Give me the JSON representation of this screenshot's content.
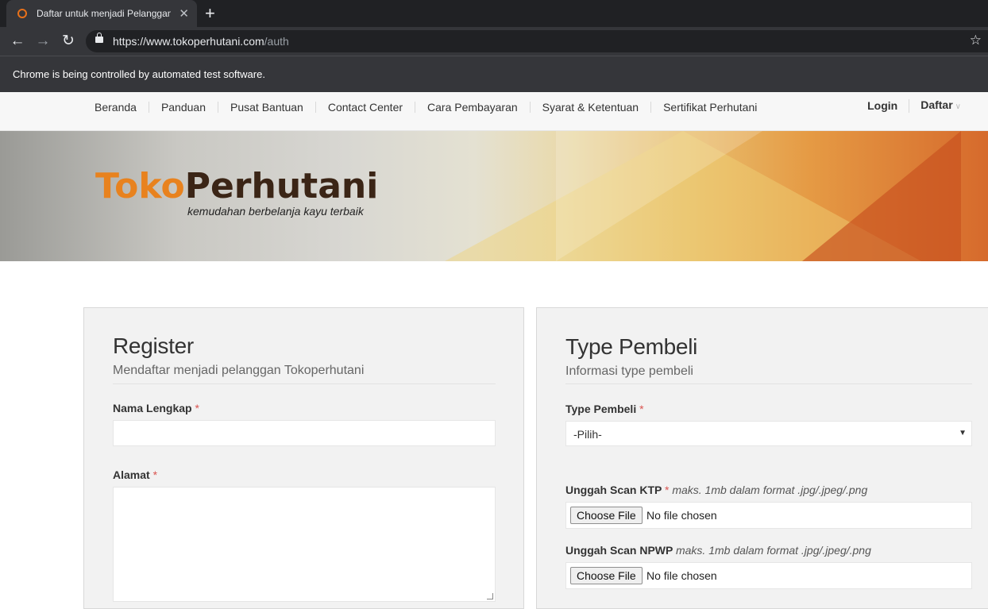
{
  "browser": {
    "tab_title": "Daftar untuk menjadi Pelanggan",
    "url_host": "https://www.tokoperhutani.com",
    "url_path": "/auth",
    "infobar_text": "Chrome is being controlled by automated test software."
  },
  "nav": {
    "items": [
      "Beranda",
      "Panduan",
      "Pusat Bantuan",
      "Contact Center",
      "Cara Pembayaran",
      "Syarat & Ketentuan",
      "Sertifikat Perhutani"
    ],
    "login": "Login",
    "daftar": "Daftar"
  },
  "banner": {
    "logo_part1": "Toko",
    "logo_part2": "Perhutani",
    "tagline": "kemudahan berbelanja kayu terbaik"
  },
  "register": {
    "title": "Register",
    "subtitle": "Mendaftar menjadi pelanggan Tokoperhutani",
    "nama_label": "Nama Lengkap",
    "nama_value": "",
    "alamat_label": "Alamat",
    "alamat_value": "",
    "required_mark": "*"
  },
  "type_pembeli": {
    "title": "Type Pembeli",
    "subtitle": "Informasi type pembeli",
    "select_label": "Type Pembeli",
    "select_value": "-Pilih-",
    "ktp_label": "Unggah Scan KTP",
    "ktp_hint": "maks. 1mb dalam format .jpg/.jpeg/.png",
    "npwp_label": "Unggah Scan NPWP",
    "npwp_hint": "maks. 1mb dalam format .jpg/.jpeg/.png",
    "file_button": "Choose File",
    "file_status": "No file chosen"
  }
}
